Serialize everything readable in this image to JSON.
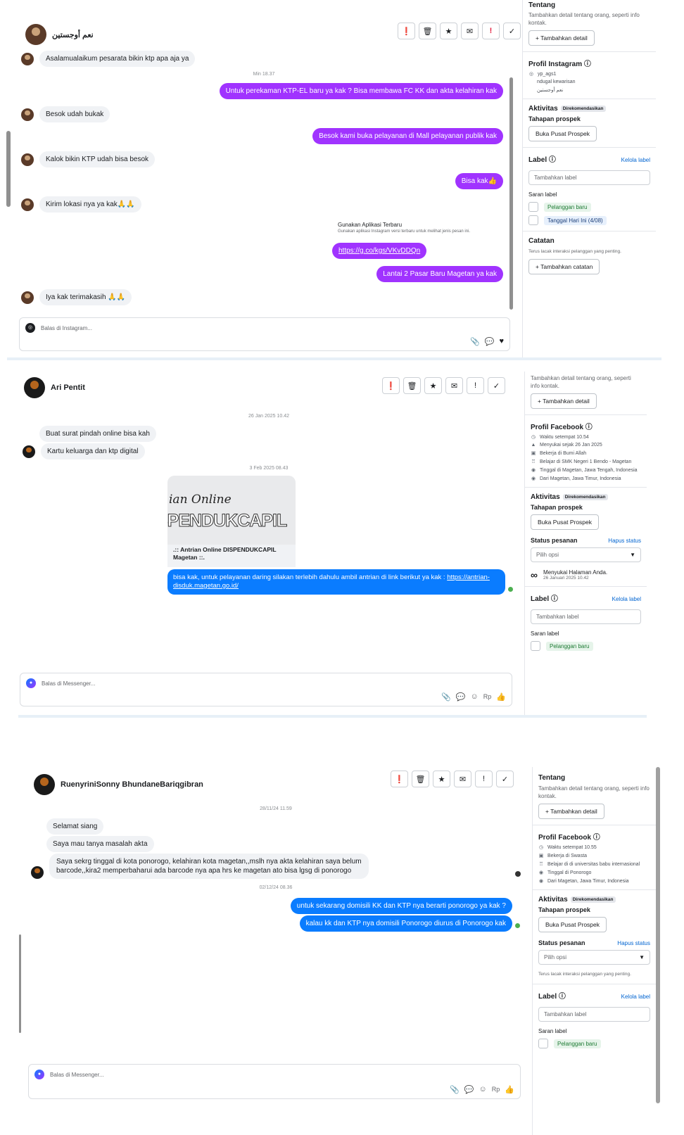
{
  "p1": {
    "header": {
      "name": "نعم أوجستين"
    },
    "msgs": [
      {
        "text": "Asalamualaikum pesarata bikin ktp apa aja ya"
      },
      {
        "text": "Untuk perekaman KTP-EL baru ya kak ? Bisa membawa FC KK dan akta kelahiran kak"
      },
      {
        "text": "Besok udah bukak"
      },
      {
        "text": "Besok kami buka pelayanan di Mall pelayanan publik kak"
      },
      {
        "text": "Kalok bikin KTP udah bisa besok"
      },
      {
        "text": "Bisa kak👍"
      },
      {
        "text": "Kirim lokasi nya ya kak🙏🙏"
      },
      {
        "text": "https://g.co/kgs/VKvDDQn"
      },
      {
        "text": "Lantai 2 Pasar Baru Magetan ya kak"
      },
      {
        "text": "Iya kak terimakasih 🙏🙏"
      }
    ],
    "timestamp": "Min 18.37",
    "app_notice": {
      "title": "Gunakan Aplikasi Terbaru",
      "desc": "Gunakan aplikasi Instagram versi terbaru untuk melihat jenis pesan ini."
    },
    "composer": {
      "placeholder": "Balas di Instagram..."
    },
    "side": {
      "top_title": "Tentang",
      "about_desc": "Tambahkan detail tentang orang, seperti info kontak.",
      "add_detail": "Tambahkan detail",
      "profile_title": "Profil Instagram",
      "ig_handle": "yp_ags1",
      "ig_line2": "ndugal kewarisan",
      "ig_line3": "نعم أوجستين",
      "activity_title": "Aktivitas",
      "recommended": "Direkomendasikan",
      "stage_label": "Tahapan prospek",
      "stage_button": "Buka Pusat Prospek",
      "label_title": "Label",
      "manage_label": "Kelola label",
      "label_placeholder": "Tambahkan label",
      "suggest": "Saran label",
      "tag1": "Pelanggan baru",
      "tag2": "Tanggal Hari Ini (4/08)",
      "notes_title": "Catatan",
      "notes_desc": "Terus lacak interaksi pelanggan yang penting.",
      "add_note": "Tambahkan catatan"
    }
  },
  "p2": {
    "header": {
      "name": "Ari Pentit"
    },
    "ts1": "26 Jan 2025 10.42",
    "msgs": [
      {
        "text": "Buat surat pindah online bisa kah"
      },
      {
        "text": "Kartu keluarga dan ktp digital"
      }
    ],
    "ts2": "3 Feb 2025 08.43",
    "card": {
      "img_line1": "ian Online",
      "img_line2": "SPENDUKCAPIL",
      "caption": ".:: Antrian Online DISPENDUKCAPIL Magetan ::."
    },
    "reply": "bisa kak, untuk pelayanan daring silakan terlebih dahulu ambil antrian di link berikut ya kak :",
    "reply_link": "https://antrian-disduk.magetan.go.id/",
    "composer": {
      "placeholder": "Balas di Messenger..."
    },
    "side": {
      "about_desc": "Tambahkan detail tentang orang, seperti info kontak.",
      "add_detail": "Tambahkan detail",
      "profile_title": "Profil Facebook",
      "info": [
        "Waktu setempat 10.54",
        "Menyukai sejak 26 Jan 2025",
        "Bekerja di Bumi Allah",
        "Belajar di SMK Negeri 1 Bendo - Magetan",
        "Tinggal di Magetan, Jawa Tengah, Indonesia",
        "Dari Magetan, Jawa Timur, Indonesia"
      ],
      "activity_title": "Aktivitas",
      "recommended": "Direkomendasikan",
      "stage_label": "Tahapan prospek",
      "stage_button": "Buka Pusat Prospek",
      "order_label": "Status pesanan",
      "clear_status": "Hapus status",
      "select_placeholder": "Pilih opsi",
      "liked_page": "Menyukai Halaman Anda.",
      "liked_date": "26 Januari 2025 10.42",
      "label_title": "Label",
      "manage_label": "Kelola label",
      "label_placeholder": "Tambahkan label",
      "suggest": "Saran label",
      "tag1": "Pelanggan baru"
    }
  },
  "p3": {
    "header": {
      "name": "RuenyriniSonny BhundaneBariqgibran"
    },
    "ts1": "28/11/24 11.59",
    "msgs": [
      {
        "text": "Selamat siang"
      },
      {
        "text": "Saya mau tanya masalah akta"
      },
      {
        "text": "Saya sekrg tinggal di kota ponorogo, kelahiran kota magetan,,mslh nya akta kelahiran saya belum"
      },
      {
        "text": "barcode,,kira2 memperbaharui ada barcode nya apa hrs ke magetan ato bisa lgsg di ponorogo"
      }
    ],
    "ts2": "02/12/24 08.36",
    "replies": [
      {
        "text": "untuk sekarang domisili KK dan KTP nya berarti ponorogo ya kak ?"
      },
      {
        "text": "kalau kk dan KTP nya domisili Ponorogo diurus di Ponorogo kak"
      }
    ],
    "composer": {
      "placeholder": "Balas di Messenger..."
    },
    "side": {
      "about_title": "Tentang",
      "about_desc": "Tambahkan detail tentang orang, seperti info kontak.",
      "add_detail": "Tambahkan detail",
      "profile_title": "Profil Facebook",
      "info": [
        "Waktu setempat 10.55",
        "Bekerja di Swasta",
        "Belajar di di universitas babu internasional",
        "Tinggal di Ponorogo",
        "Dari Magetan, Jawa Timur, Indonesia"
      ],
      "activity_title": "Aktivitas",
      "recommended": "Direkomendasikan",
      "stage_label": "Tahapan prospek",
      "stage_button": "Buka Pusat Prospek",
      "order_label": "Status pesanan",
      "clear_status": "Hapus status",
      "select_placeholder": "Pilih opsi",
      "track_desc": "Terus lacak interaksi pelanggan yang penting.",
      "label_title": "Label",
      "manage_label": "Kelola label",
      "label_placeholder": "Tambahkan label",
      "suggest": "Saran label",
      "tag1": "Pelanggan baru"
    }
  },
  "toolbar": {
    "icons": [
      "alert-icon",
      "trash-icon",
      "star-icon",
      "mail-icon",
      "exclamation-icon",
      "check-icon"
    ]
  },
  "composer_actions": {
    "currency": "Rp"
  }
}
